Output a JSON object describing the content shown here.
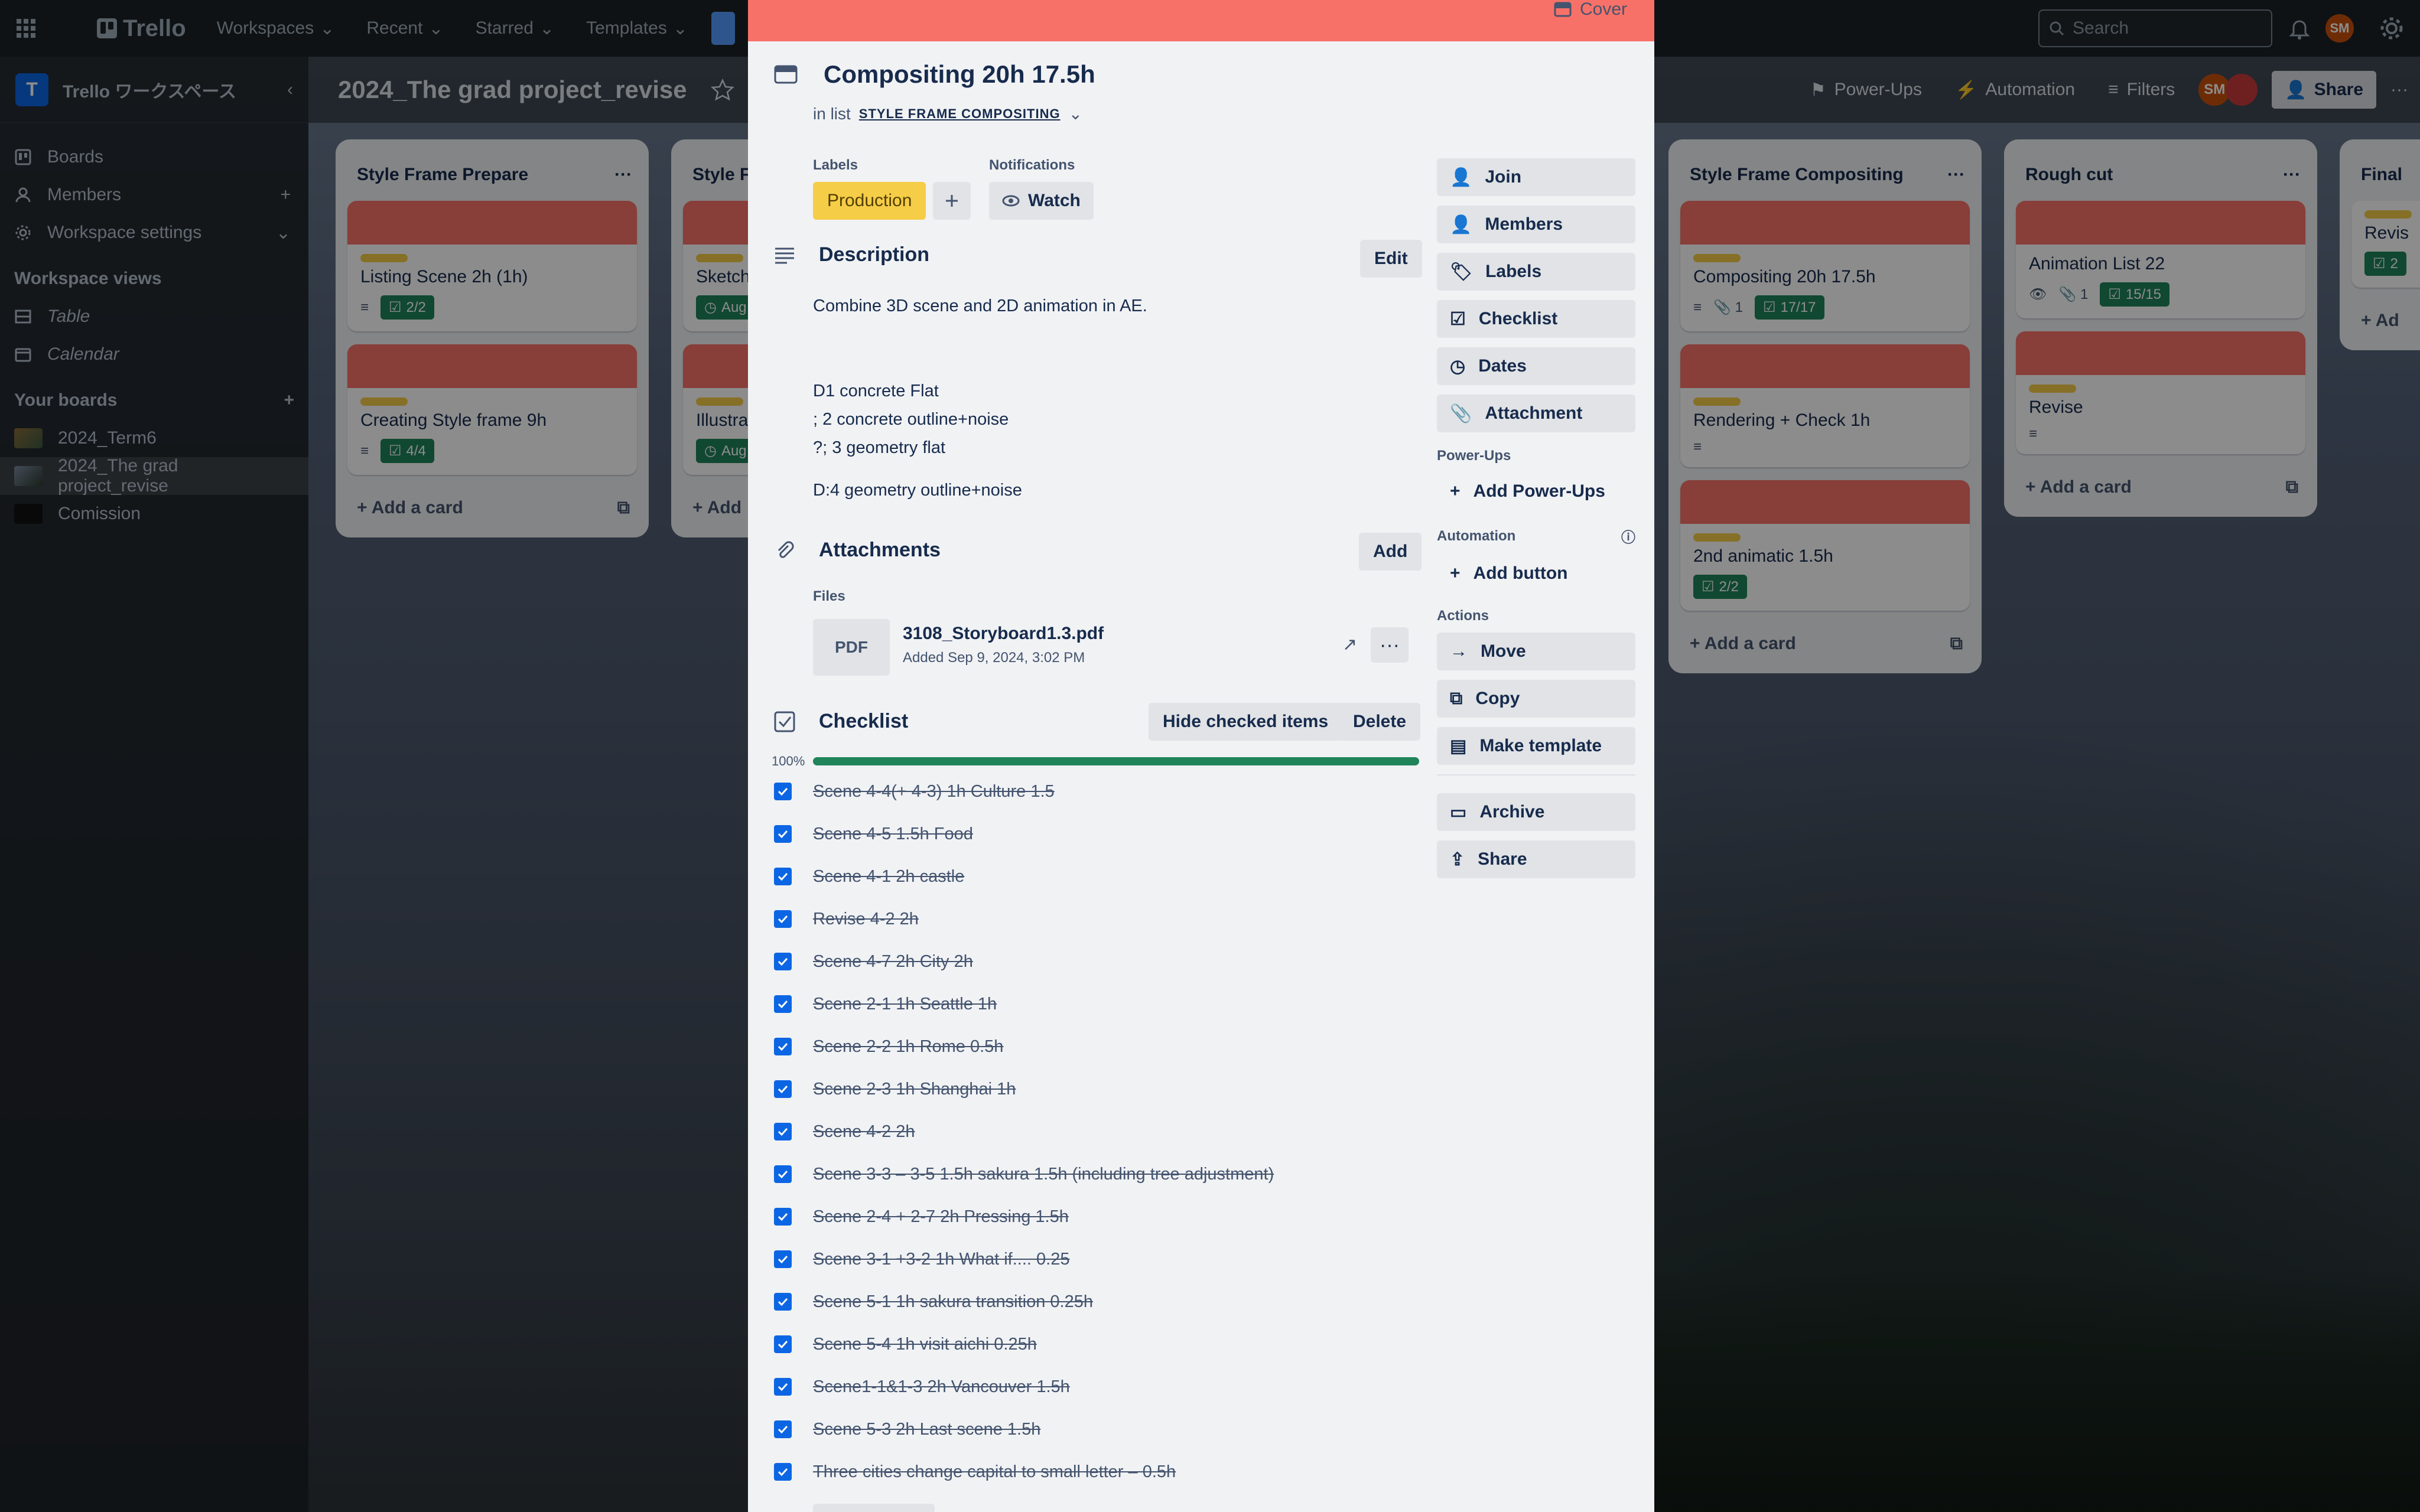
{
  "topbar": {
    "app_name": "Trello",
    "menu": [
      "Workspaces",
      "Recent",
      "Starred",
      "Templates"
    ],
    "search_placeholder": "Search",
    "avatar_initials": "SM"
  },
  "sidebar": {
    "workspace_initial": "T",
    "workspace_name": "Trello ワークスペース",
    "items": [
      "Boards",
      "Members",
      "Workspace settings"
    ],
    "views_heading": "Workspace views",
    "views": [
      "Table",
      "Calendar"
    ],
    "boards_heading": "Your boards",
    "boards": [
      "2024_Term6",
      "2024_The grad project_revise",
      "Comission"
    ]
  },
  "board": {
    "title": "2024_The grad project_revise",
    "header_buttons": [
      "Power-Ups",
      "Automation",
      "Filters"
    ],
    "share_label": "Share",
    "avatar_initials": "SM"
  },
  "lists": [
    {
      "title": "Style Frame Prepare",
      "cards": [
        {
          "title": "Listing Scene 2h (1h)",
          "check": "2/2"
        },
        {
          "title": "Creating Style frame 9h",
          "check": "4/4"
        }
      ],
      "add_label": "Add a card"
    },
    {
      "title": "Style Fr",
      "cards": [
        {
          "title": "Sketch",
          "check": "Aug"
        },
        {
          "title": "Illustrat",
          "check": "Aug"
        }
      ],
      "add_label": "Add"
    },
    {
      "title": "Style Frame Compositing",
      "cards": [
        {
          "title": "Compositing 20h 17.5h",
          "attach": "1",
          "check": "17/17"
        },
        {
          "title": "Rendering + Check 1h"
        },
        {
          "title": "2nd animatic 1.5h",
          "check": "2/2"
        }
      ],
      "add_label": "Add a card"
    },
    {
      "title": "Rough cut",
      "cards": [
        {
          "title": "Animation List 22",
          "attach": "1",
          "check": "15/15"
        },
        {
          "title": "Revise"
        }
      ],
      "add_label": "Add a card"
    },
    {
      "title": "Final",
      "cards": [
        {
          "title": "Revis",
          "check": "2"
        }
      ],
      "add_label": "Ad"
    }
  ],
  "modal": {
    "cover_label": "Cover",
    "card_title": "Compositing 20h 17.5h",
    "in_list_prefix": "in list",
    "list_name": "STYLE FRAME COMPOSITING",
    "labels_heading": "Labels",
    "label_name": "Production",
    "notifications_heading": "Notifications",
    "watch_label": "Watch",
    "description_heading": "Description",
    "edit_label": "Edit",
    "description_lines": [
      "Combine 3D scene and 2D animation in AE.",
      "",
      "",
      "D1 concrete Flat",
      "; 2 concrete outline+noise",
      "?; 3 geometry flat",
      "",
      "D:4 geometry outline+noise"
    ],
    "attachments_heading": "Attachments",
    "add_label": "Add",
    "files_heading": "Files",
    "file": {
      "type": "PDF",
      "name": "3108_Storyboard1.3.pdf",
      "added": "Added Sep 9, 2024, 3:02 PM"
    },
    "checklist_heading": "Checklist",
    "hide_checked_label": "Hide checked items",
    "delete_label": "Delete",
    "progress_text": "100%",
    "progress_value": 1.0,
    "checklist_items": [
      "Scene 4-4(+ 4-3)  1h Culture 1.5",
      "Scene 4-5 1.5h Food",
      "Scene 4-1 2h castle",
      "Revise 4-2 2h",
      "Scene 4-7 2h City 2h",
      "Scene 2-1 1h Seattle 1h",
      "Scene 2-2 1h Rome 0.5h",
      "Scene 2-3 1h Shanghai 1h",
      "Scene 4-2 2h",
      "Scene 3-3 – 3-5 1.5h sakura 1.5h (including tree adjustment)",
      "Scene 2-4 + 2-7 2h Pressing 1.5h",
      "Scene 3-1 +3-2 1h What if.... 0.25",
      "Scene 5-1 1h sakura transition 0.25h",
      "Scene 5-4 1h visit aichi 0.25h",
      "Scene1-1&1-3 2h Vancouver 1.5h",
      "Scene 5-3 2h Last scene 1.5h",
      "Three cities change capital to small letter – 0.5h"
    ],
    "side": {
      "buttons": [
        "Join",
        "Members",
        "Labels",
        "Checklist",
        "Dates",
        "Attachment"
      ],
      "powerups_heading": "Power-Ups",
      "add_powerups": "Add Power-Ups",
      "automation_heading": "Automation",
      "add_button": "Add button",
      "actions_heading": "Actions",
      "actions": [
        "Move",
        "Copy",
        "Make template"
      ],
      "archive": "Archive",
      "share": "Share"
    }
  }
}
